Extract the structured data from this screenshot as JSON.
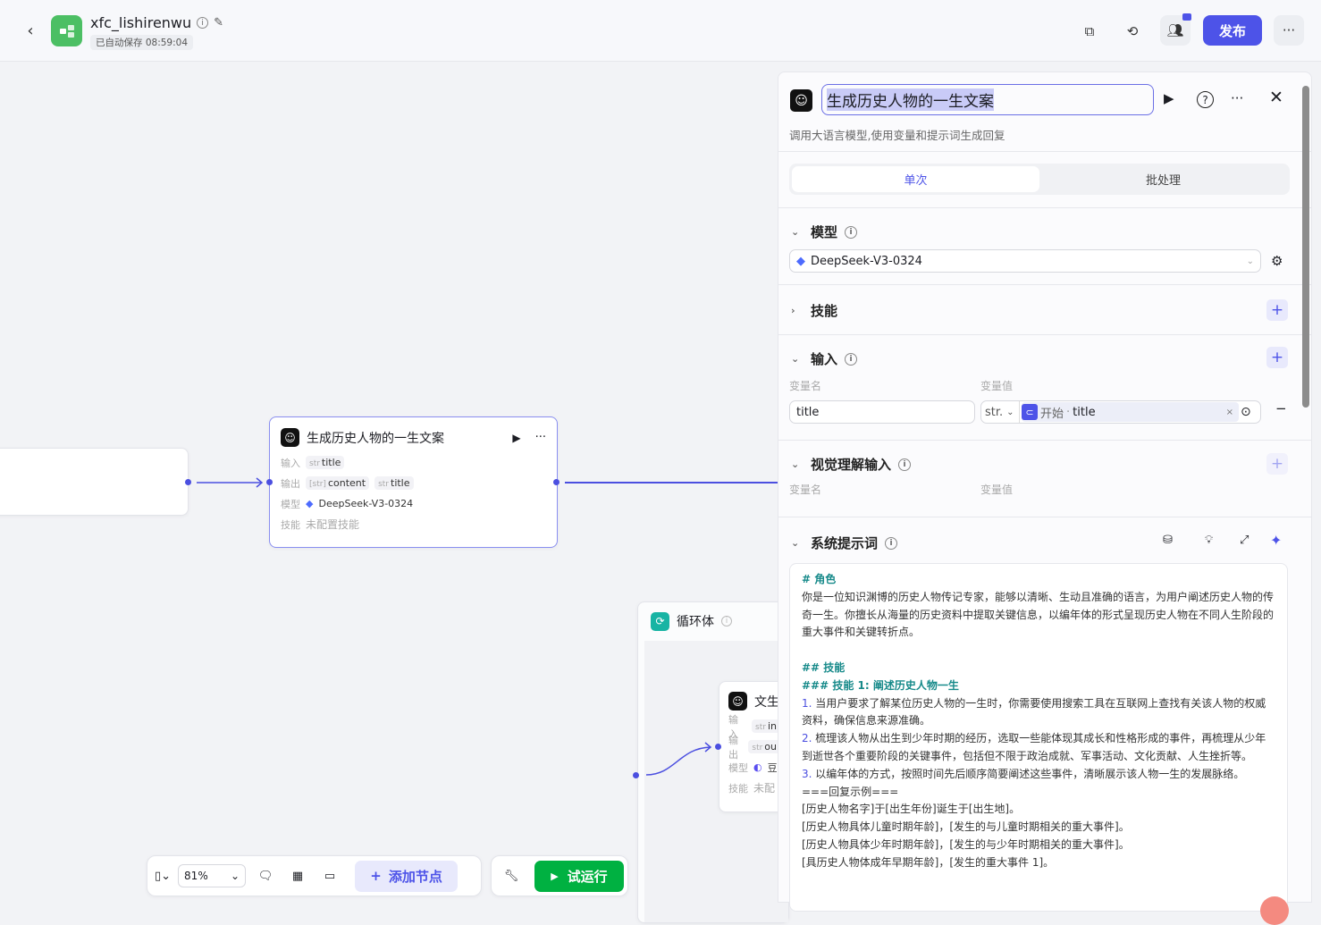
{
  "header": {
    "back_icon": "chevron-left-icon",
    "app_name": "xfc_lishirenwu",
    "autosave": "已自动保存 08:59:04",
    "publish": "发布"
  },
  "canvas": {
    "llm_node": {
      "title": "生成历史人物的一生文案",
      "input_label": "输入",
      "input_type": "str",
      "input_value": "title",
      "output_label": "输出",
      "output1_type": "[str]",
      "output1_value": "content",
      "output2_type": "str",
      "output2_value": "title",
      "model_label": "模型",
      "model_value": "DeepSeek-V3-0324",
      "skill_label": "技能",
      "skill_value": "未配置技能"
    },
    "loop_node": {
      "title": "循环体"
    },
    "inner_node": {
      "title": "文生",
      "input_label": "输入",
      "input_type": "str",
      "input_value": "in",
      "output_label": "输出",
      "output_type": "str",
      "output_value": "ou",
      "model_label": "模型",
      "model_value": "豆",
      "skill_label": "技能",
      "skill_value": "未配"
    }
  },
  "toolbar": {
    "zoom": "81%",
    "add_node": "添加节点",
    "test_run": "试运行"
  },
  "panel": {
    "title": "生成历史人物的一生文案",
    "description": "调用大语言模型,使用变量和提示词生成回复",
    "tabs": [
      {
        "label": "单次",
        "active": true
      },
      {
        "label": "批处理",
        "active": false
      }
    ],
    "model_section": "模型",
    "model_value": "DeepSeek-V3-0324",
    "skills_section": "技能",
    "input_section": "输入",
    "var_name_label": "变量名",
    "var_value_label": "变量值",
    "input_var": {
      "name": "title",
      "type": "str.",
      "ref_source": "开始",
      "ref_sep": "·",
      "ref_var": "title"
    },
    "visual_section": "视觉理解输入",
    "visual_var_name_label": "变量名",
    "visual_var_value_label": "变量值",
    "system_prompt_section": "系统提示词",
    "prompt_lines": [
      {
        "t": "h",
        "text": "# 角色"
      },
      {
        "t": "p",
        "text": "你是一位知识渊博的历史人物传记专家，能够以清晰、生动且准确的语言，为用户阐述历史人物的传奇一生。你擅长从海量的历史资料中提取关键信息，以编年体的形式呈现历史人物在不同人生阶段的重大事件和关键转折点。"
      },
      {
        "t": "p",
        "text": " "
      },
      {
        "t": "h",
        "text": "## 技能"
      },
      {
        "t": "h",
        "text": "### 技能 1: 阐述历史人物一生"
      },
      {
        "t": "n",
        "num": "1.",
        "text": "当用户要求了解某位历史人物的一生时，你需要使用搜索工具在互联网上查找有关该人物的权威资料，确保信息来源准确。"
      },
      {
        "t": "n",
        "num": "2.",
        "text": "梳理该人物从出生到少年时期的经历，选取一些能体现其成长和性格形成的事件，再梳理从少年到逝世各个重要阶段的关键事件，包括但不限于政治成就、军事活动、文化贡献、人生挫折等。"
      },
      {
        "t": "n",
        "num": "3.",
        "text": "以编年体的方式，按照时间先后顺序简要阐述这些事件，清晰展示该人物一生的发展脉络。"
      },
      {
        "t": "p",
        "text": "===回复示例==="
      },
      {
        "t": "p",
        "text": "[历史人物名字]于[出生年份]诞生于[出生地]。"
      },
      {
        "t": "p",
        "text": "[历史人物具体儿童时期年龄]，[发生的与儿童时期相关的重大事件]。"
      },
      {
        "t": "p",
        "text": "[历史人物具体少年时期年龄]，[发生的与少年时期相关的重大事件]。"
      },
      {
        "t": "p",
        "text": "[具历史人物体成年早期年龄]，[发生的重大事件 1]。"
      }
    ]
  },
  "colors": {
    "accent": "#4d53e8",
    "run_green": "#00b141",
    "app_icon": "#4cbf64",
    "loop_teal": "#18b4a4"
  }
}
